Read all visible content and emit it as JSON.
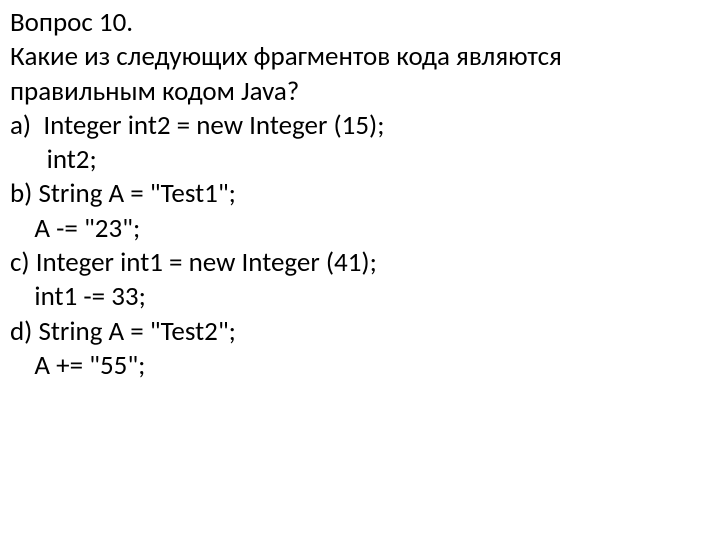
{
  "lines": [
    "Вопрос 10.",
    "Какие из следующих фрагментов кода являются",
    "правильным кодом Java?",
    "a)  Integer int2 = new Integer (15);",
    "      int2;",
    "b) String A = \"Test1\";",
    "    A -= \"23\";",
    "c) Integer int1 = new Integer (41);",
    "    int1 -= 33;",
    "d) String A = \"Test2\";",
    "    A += \"55\";"
  ]
}
